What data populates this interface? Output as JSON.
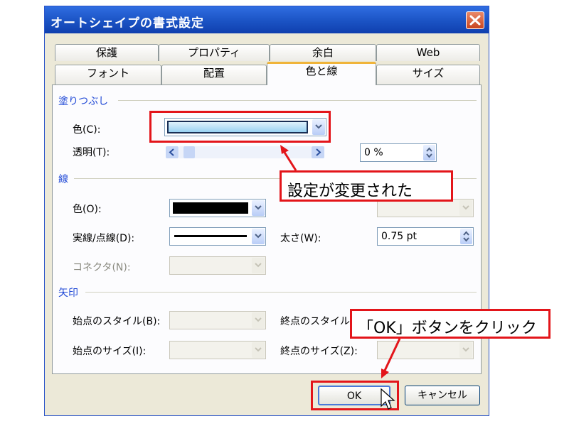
{
  "window": {
    "title": "オートシェイプの書式設定"
  },
  "tabs": {
    "back": [
      "保護",
      "プロパティ",
      "余白",
      "Web"
    ],
    "front": [
      "フォント",
      "配置",
      "色と線",
      "サイズ"
    ],
    "active": "色と線"
  },
  "fill": {
    "section": "塗りつぶし",
    "color_label": "色(C):",
    "transparency_label": "透明(T):",
    "transparency_value": "0 %",
    "fill_color": "#bfe3f7"
  },
  "line": {
    "section": "線",
    "color_label": "色(O):",
    "style_label": "実線/点線(D):",
    "weight_label": "太さ(W):",
    "weight_value": "0.75 pt",
    "connector_label": "コネクタ(N):"
  },
  "arrows": {
    "section": "矢印",
    "begin_style": "始点のスタイル(B):",
    "begin_size": "始点のサイズ(I):",
    "end_style": "終点のスタイル",
    "end_size": "終点のサイズ(Z):"
  },
  "buttons": {
    "ok": "OK",
    "cancel": "キャンセル"
  },
  "annotations": {
    "changed": "設定が変更された",
    "click_ok": "「OK」ボタンをクリック"
  },
  "colors": {
    "highlight": "#e3151a",
    "titlebar": "#1b53c4"
  }
}
